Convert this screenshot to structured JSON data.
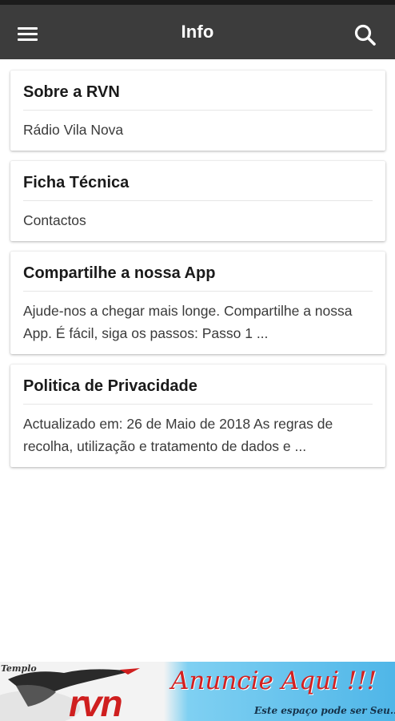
{
  "app_bar": {
    "title": "Info",
    "menu_icon": "hamburger-menu-icon",
    "search_icon": "search-icon",
    "background": "#3c3c3c"
  },
  "cards": [
    {
      "title": "Sobre a RVN",
      "body": "Rádio Vila Nova"
    },
    {
      "title": "Ficha Técnica",
      "body": "Contactos"
    },
    {
      "title": "Compartilhe a nossa App",
      "body": "Ajude-nos a chegar mais longe. Compartilhe a nossa App. É fácil, siga os passos: Passo 1 ..."
    },
    {
      "title": "Politica de Privacidade",
      "body": "Actualizado em: 26 de Maio de 2018 As regras de recolha, utilização e tratamento de dados e ..."
    }
  ],
  "ad": {
    "tag": "Templo",
    "logo": "rvn",
    "headline": "Anuncie Aqui !!!",
    "subline": "Este espaço pode ser Seu..."
  }
}
